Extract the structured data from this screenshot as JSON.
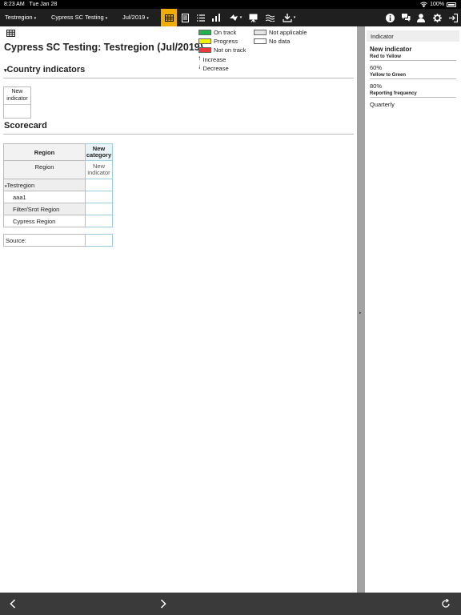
{
  "status": {
    "time": "8:23 AM",
    "date": "Tue Jan 28",
    "battery": "100%"
  },
  "toolbar": {
    "region": "Testregion",
    "scorecard": "Cypress SC Testing",
    "period": "Jul/2019",
    "caret": "▾",
    "icons": [
      "table-icon",
      "document-icon",
      "list-icon",
      "bar-chart-icon",
      "map-icon",
      "presentation-icon",
      "waves-icon",
      "download-icon",
      "info-icon",
      "comments-icon",
      "user-icon",
      "gear-icon",
      "logout-icon"
    ],
    "accent": "#f0ad00"
  },
  "main": {
    "title": "Cypress SC Testing: Testregion (Jul/2019)",
    "country_section": {
      "toggle": "▾",
      "title": "Country indicators"
    },
    "indicator_box": {
      "label": "New indicator"
    },
    "scorecard_title": "Scorecard",
    "table": {
      "header_region": "Region",
      "header_category": "New category",
      "sub_region": "Region",
      "sub_indicator": "New indicator",
      "group_toggle": "▾",
      "group": "Testregion",
      "rows": [
        "aaa1",
        "Filter/Srot Region",
        "Cypress Region"
      ],
      "source_label": "Source:"
    }
  },
  "legend": {
    "on_track": "On track",
    "progress": "Progress",
    "not_on_track": "Not on track",
    "increase": "Increase",
    "decrease": "Decrease",
    "not_applicable": "Not applicable",
    "no_data": "No data",
    "colors": {
      "on_track": "#22b14c",
      "progress": "#f2f200",
      "not_on_track": "#e83b3b",
      "not_applicable": "#e5e5e5",
      "no_data": "#ffffff"
    }
  },
  "side": {
    "header": "Indicator",
    "title": "New indicator",
    "red_to_yellow_label": "Red to Yellow",
    "red_to_yellow_value": "60%",
    "yellow_to_green_label": "Yellow to Green",
    "yellow_to_green_value": "80%",
    "frequency_label": "Reporting frequency",
    "frequency_value": "Quarterly"
  },
  "divider": {
    "arrow": "▸"
  }
}
